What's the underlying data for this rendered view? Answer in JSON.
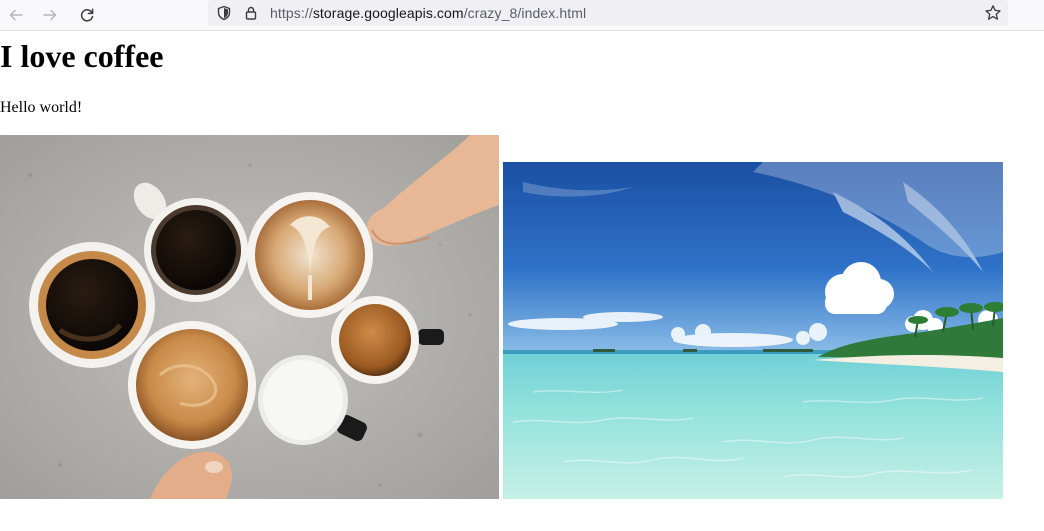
{
  "browser": {
    "url_scheme": "https://",
    "url_host": "storage.googleapis.com",
    "url_path": "/crazy_8/index.html",
    "icons": [
      "back-arrow-icon",
      "forward-arrow-icon",
      "reload-icon",
      "shield-icon",
      "lock-icon",
      "star-icon"
    ]
  },
  "page": {
    "heading": "I love coffee",
    "paragraph": "Hello world!",
    "images": [
      {
        "subject": "coffee cups on concrete table"
      },
      {
        "subject": "tropical beach with turquoise water"
      }
    ]
  }
}
